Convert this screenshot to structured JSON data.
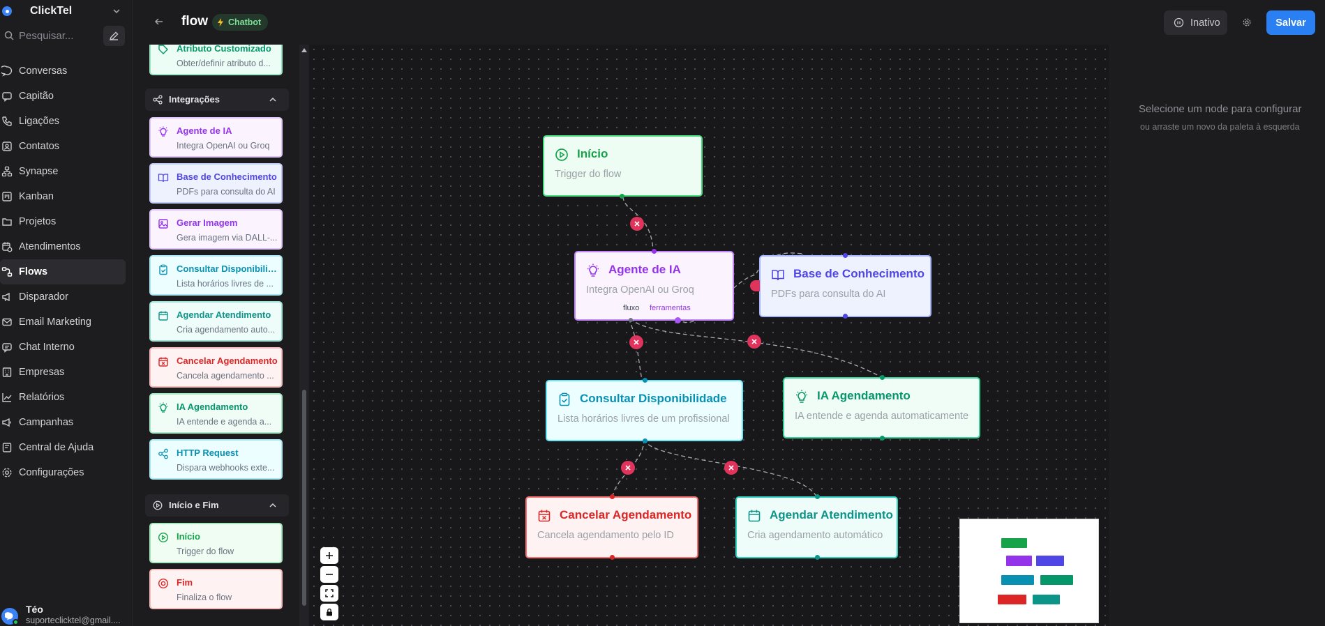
{
  "sidebar": {
    "brand": "ClickTel",
    "search_placeholder": "Pesquisar...",
    "items": [
      {
        "label": "Conversas",
        "icon": "chat-icon"
      },
      {
        "label": "Capitão",
        "icon": "message-square-icon"
      },
      {
        "label": "Ligações",
        "icon": "phone-icon"
      },
      {
        "label": "Contatos",
        "icon": "contact-icon"
      },
      {
        "label": "Synapse",
        "icon": "network-icon"
      },
      {
        "label": "Kanban",
        "icon": "kanban-icon"
      },
      {
        "label": "Projetos",
        "icon": "folder-icon"
      },
      {
        "label": "Atendimentos",
        "icon": "calendar-clock-icon"
      },
      {
        "label": "Flows",
        "icon": "flow-icon",
        "active": true
      },
      {
        "label": "Disparador",
        "icon": "megaphone-icon"
      },
      {
        "label": "Email Marketing",
        "icon": "mail-icon"
      },
      {
        "label": "Chat Interno",
        "icon": "chat-internal-icon"
      },
      {
        "label": "Empresas",
        "icon": "building-icon"
      },
      {
        "label": "Relatórios",
        "icon": "chart-icon"
      },
      {
        "label": "Campanhas",
        "icon": "campaign-icon"
      },
      {
        "label": "Central de Ajuda",
        "icon": "book-open-icon"
      },
      {
        "label": "Configurações",
        "icon": "gear-icon"
      }
    ],
    "user": {
      "name": "Téo",
      "email": "suporteclicktel@gmail...."
    }
  },
  "palette": {
    "top_partial": {
      "title": "Atributo Customizado",
      "desc": "Obter/definir atributo d..."
    },
    "sections": [
      {
        "title": "Integrações",
        "items": [
          {
            "title": "Agente de IA",
            "desc": "Integra OpenAI ou Groq",
            "icon": "lightbulb-icon"
          },
          {
            "title": "Base de Conhecimento",
            "desc": "PDFs para consulta do AI",
            "icon": "book-icon"
          },
          {
            "title": "Gerar Imagem",
            "desc": "Gera imagem via DALL-...",
            "icon": "image-icon"
          },
          {
            "title": "Consultar Disponibilida...",
            "desc": "Lista horários livres de ...",
            "icon": "clipboard-check-icon"
          },
          {
            "title": "Agendar Atendimento",
            "desc": "Cria agendamento auto...",
            "icon": "calendar-icon"
          },
          {
            "title": "Cancelar Agendamento",
            "desc": "Cancela agendamento ...",
            "icon": "calendar-x-icon"
          },
          {
            "title": "IA Agendamento",
            "desc": "IA entende e agenda a...",
            "icon": "lightbulb-icon"
          },
          {
            "title": "HTTP Request",
            "desc": "Dispara webhooks exte...",
            "icon": "share-icon"
          }
        ]
      },
      {
        "title": "Início e Fim",
        "items": [
          {
            "title": "Início",
            "desc": "Trigger do flow",
            "icon": "play-circle-icon"
          },
          {
            "title": "Fim",
            "desc": "Finaliza o flow",
            "icon": "stop-circle-icon"
          }
        ]
      }
    ]
  },
  "header": {
    "title": "flow",
    "badge": "Chatbot",
    "status_button": "Inativo",
    "save_button": "Salvar"
  },
  "canvas": {
    "nodes": {
      "inicio": {
        "title": "Início",
        "desc": "Trigger do flow"
      },
      "agente": {
        "title": "Agente de IA",
        "desc": "Integra OpenAI ou Groq",
        "handle_fluxo": "fluxo",
        "handle_ferramentas": "ferramentas"
      },
      "base": {
        "title": "Base de Conhecimento",
        "desc": "PDFs para consulta do AI"
      },
      "consultar": {
        "title": "Consultar Disponibilidade",
        "desc": "Lista horários livres de um profissional"
      },
      "ia_agendamento": {
        "title": "IA Agendamento",
        "desc": "IA entende e agenda automaticamente"
      },
      "cancelar": {
        "title": "Cancelar Agendamento",
        "desc": "Cancela agendamento pelo ID"
      },
      "agendar": {
        "title": "Agendar Atendimento",
        "desc": "Cria agendamento automático"
      }
    },
    "zoom_controls": [
      "+",
      "−",
      "⛶",
      "🔒"
    ]
  },
  "config_panel": {
    "title": "Selecione um node para configurar",
    "desc": "ou arraste um novo da paleta à esquerda"
  },
  "colors": {
    "green": "#16a34a",
    "purple": "#9333ea",
    "indigo": "#4f46e5",
    "cyan": "#0891b2",
    "teal": "#0d9488",
    "red": "#dc2626",
    "save": "#2a7ff2",
    "edge_delete": "#e1345d"
  }
}
